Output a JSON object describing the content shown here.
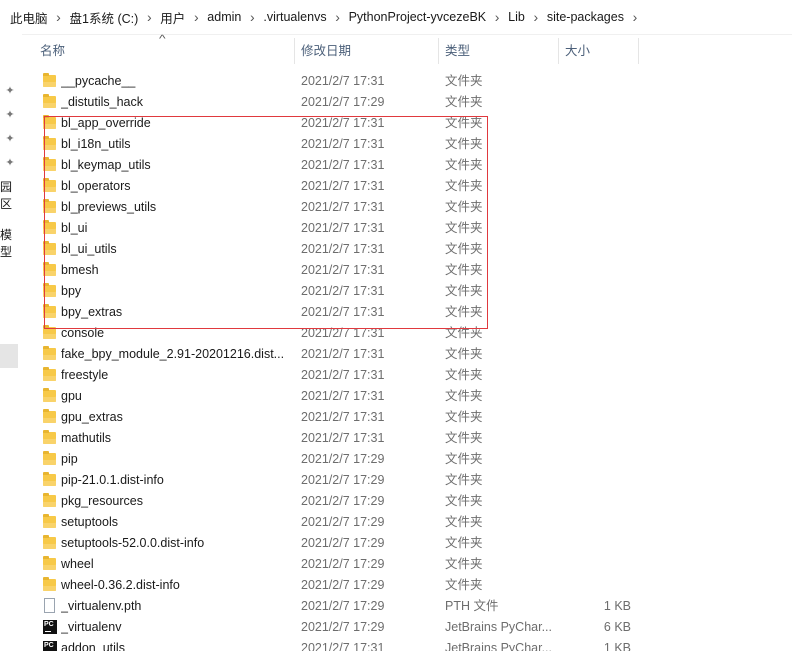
{
  "breadcrumb": [
    "此电脑",
    "盘1系统 (C:)",
    "用户",
    "admin",
    ".virtualenvs",
    "PythonProject-yvcezeBK",
    "Lib",
    "site-packages"
  ],
  "columns": {
    "name": "名称",
    "date": "修改日期",
    "type": "类型",
    "size": "大小"
  },
  "left_pane": {
    "label1": "园区",
    "label2": "模型"
  },
  "files": [
    {
      "icon": "folder-icon",
      "name": "__pycache__",
      "date": "2021/2/7 17:31",
      "type": "文件夹",
      "size": ""
    },
    {
      "icon": "folder-icon",
      "name": "_distutils_hack",
      "date": "2021/2/7 17:29",
      "type": "文件夹",
      "size": ""
    },
    {
      "icon": "folder-icon",
      "name": "bl_app_override",
      "date": "2021/2/7 17:31",
      "type": "文件夹",
      "size": ""
    },
    {
      "icon": "folder-icon",
      "name": "bl_i18n_utils",
      "date": "2021/2/7 17:31",
      "type": "文件夹",
      "size": ""
    },
    {
      "icon": "folder-icon",
      "name": "bl_keymap_utils",
      "date": "2021/2/7 17:31",
      "type": "文件夹",
      "size": ""
    },
    {
      "icon": "folder-icon",
      "name": "bl_operators",
      "date": "2021/2/7 17:31",
      "type": "文件夹",
      "size": ""
    },
    {
      "icon": "folder-icon",
      "name": "bl_previews_utils",
      "date": "2021/2/7 17:31",
      "type": "文件夹",
      "size": ""
    },
    {
      "icon": "folder-icon",
      "name": "bl_ui",
      "date": "2021/2/7 17:31",
      "type": "文件夹",
      "size": ""
    },
    {
      "icon": "folder-icon",
      "name": "bl_ui_utils",
      "date": "2021/2/7 17:31",
      "type": "文件夹",
      "size": ""
    },
    {
      "icon": "folder-icon",
      "name": "bmesh",
      "date": "2021/2/7 17:31",
      "type": "文件夹",
      "size": ""
    },
    {
      "icon": "folder-icon",
      "name": "bpy",
      "date": "2021/2/7 17:31",
      "type": "文件夹",
      "size": ""
    },
    {
      "icon": "folder-icon",
      "name": "bpy_extras",
      "date": "2021/2/7 17:31",
      "type": "文件夹",
      "size": ""
    },
    {
      "icon": "folder-icon",
      "name": "console",
      "date": "2021/2/7 17:31",
      "type": "文件夹",
      "size": ""
    },
    {
      "icon": "folder-icon",
      "name": "fake_bpy_module_2.91-20201216.dist...",
      "date": "2021/2/7 17:31",
      "type": "文件夹",
      "size": ""
    },
    {
      "icon": "folder-icon",
      "name": "freestyle",
      "date": "2021/2/7 17:31",
      "type": "文件夹",
      "size": ""
    },
    {
      "icon": "folder-icon",
      "name": "gpu",
      "date": "2021/2/7 17:31",
      "type": "文件夹",
      "size": ""
    },
    {
      "icon": "folder-icon",
      "name": "gpu_extras",
      "date": "2021/2/7 17:31",
      "type": "文件夹",
      "size": ""
    },
    {
      "icon": "folder-icon",
      "name": "mathutils",
      "date": "2021/2/7 17:31",
      "type": "文件夹",
      "size": ""
    },
    {
      "icon": "folder-icon",
      "name": "pip",
      "date": "2021/2/7 17:29",
      "type": "文件夹",
      "size": ""
    },
    {
      "icon": "folder-icon",
      "name": "pip-21.0.1.dist-info",
      "date": "2021/2/7 17:29",
      "type": "文件夹",
      "size": ""
    },
    {
      "icon": "folder-icon",
      "name": "pkg_resources",
      "date": "2021/2/7 17:29",
      "type": "文件夹",
      "size": ""
    },
    {
      "icon": "folder-icon",
      "name": "setuptools",
      "date": "2021/2/7 17:29",
      "type": "文件夹",
      "size": ""
    },
    {
      "icon": "folder-icon",
      "name": "setuptools-52.0.0.dist-info",
      "date": "2021/2/7 17:29",
      "type": "文件夹",
      "size": ""
    },
    {
      "icon": "folder-icon",
      "name": "wheel",
      "date": "2021/2/7 17:29",
      "type": "文件夹",
      "size": ""
    },
    {
      "icon": "folder-icon",
      "name": "wheel-0.36.2.dist-info",
      "date": "2021/2/7 17:29",
      "type": "文件夹",
      "size": ""
    },
    {
      "icon": "file-icon",
      "name": "_virtualenv.pth",
      "date": "2021/2/7 17:29",
      "type": "PTH 文件",
      "size": "1 KB"
    },
    {
      "icon": "pycharm-icon",
      "name": "_virtualenv",
      "date": "2021/2/7 17:29",
      "type": "JetBrains PyChar...",
      "size": "6 KB"
    },
    {
      "icon": "pycharm-icon",
      "name": "addon_utils",
      "date": "2021/2/7 17:31",
      "type": "JetBrains PyChar...",
      "size": "1 KB"
    }
  ],
  "colors": {
    "annotation": "#e0393e",
    "header_text": "#4c607a",
    "folder": "#f7c948"
  }
}
